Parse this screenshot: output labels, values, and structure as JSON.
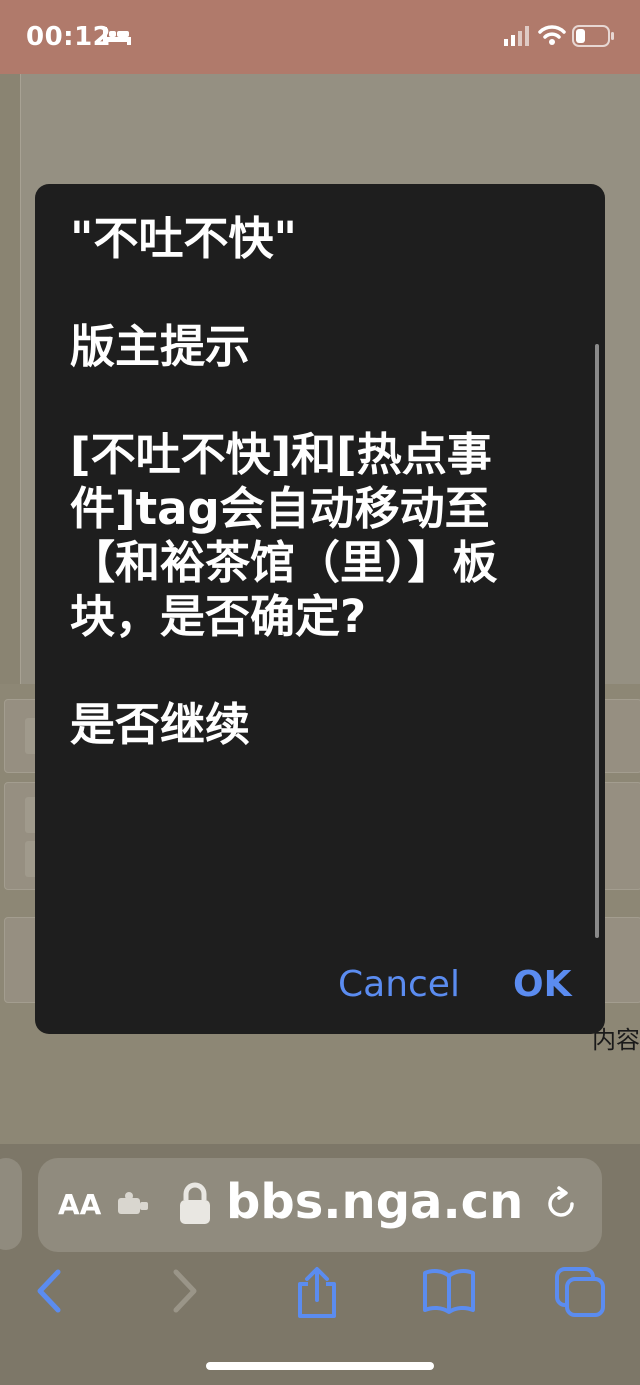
{
  "status_bar": {
    "time": "00:12",
    "icons": [
      "bed-icon",
      "signal-icon",
      "wifi-icon",
      "battery-icon"
    ]
  },
  "dialog": {
    "title": "\"不吐不快\"",
    "subtitle": "版主提示",
    "message": "[不吐不快]和[热点事件]tag会自动移动至【和裕茶馆（里）】板块，是否确定?",
    "question": "是否继续",
    "cancel_label": "Cancel",
    "ok_label": "OK",
    "button_color": "#5b8cf0"
  },
  "background": {
    "side_text": "内容"
  },
  "browser": {
    "text_size_label": "AA",
    "url": "bbs.nga.cn",
    "toolbar_icons": [
      "back-icon",
      "forward-icon",
      "share-icon",
      "bookmarks-icon",
      "tabs-icon"
    ]
  }
}
